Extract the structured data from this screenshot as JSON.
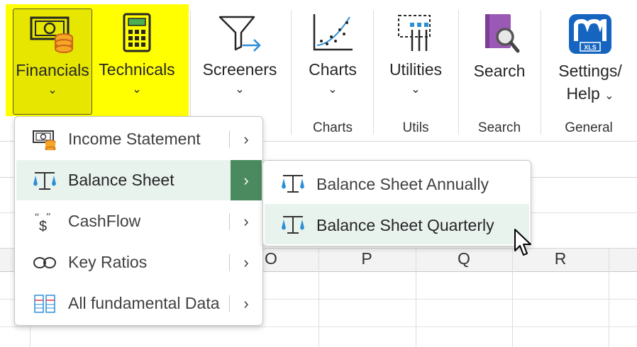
{
  "ribbon": {
    "buttons": {
      "financials": "Financials",
      "technicals": "Technicals",
      "screeners": "Screeners",
      "charts": "Charts",
      "utilities": "Utilities",
      "search": "Search",
      "settings_line1": "Settings/",
      "settings_line2": "Help"
    },
    "groups": {
      "charts": "Charts",
      "utils": "Utils",
      "search": "Search",
      "general": "General"
    },
    "highlight_color": "#ffff00"
  },
  "menu": {
    "items": [
      {
        "label": "Income Statement",
        "icon": "income-statement-icon"
      },
      {
        "label": "Balance Sheet",
        "icon": "balance-scale-icon"
      },
      {
        "label": "CashFlow",
        "icon": "cashflow-dollar-icon"
      },
      {
        "label": "Key Ratios",
        "icon": "infinity-icon"
      },
      {
        "label": "All fundamental Data",
        "icon": "data-grid-icon"
      }
    ],
    "active_index": 1,
    "accent": "#4a8a5e"
  },
  "submenu": {
    "items": [
      {
        "label": "Balance Sheet Annually",
        "icon": "balance-scale-icon"
      },
      {
        "label": "Balance Sheet Quarterly",
        "icon": "balance-scale-icon"
      }
    ],
    "hover_index": 1
  },
  "sheet": {
    "columns": [
      "O",
      "P",
      "Q",
      "R"
    ]
  }
}
